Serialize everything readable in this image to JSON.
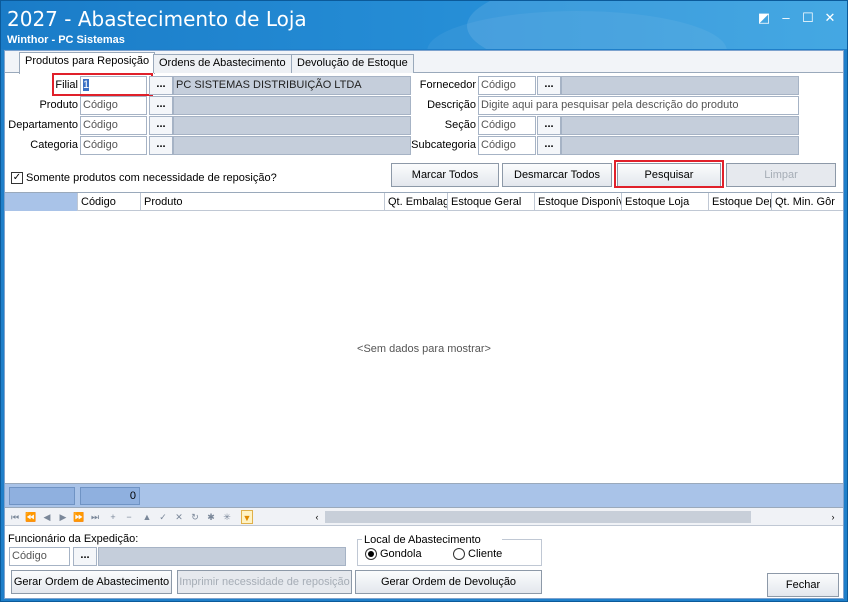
{
  "window": {
    "title": "2027 - Abastecimento de Loja",
    "subtitle": "Winthor - PC Sistemas",
    "buttons": [
      "restore-icon",
      "minimize-icon",
      "maximize-icon",
      "close-icon"
    ]
  },
  "tabs": [
    {
      "label": "Produtos para Reposição",
      "active": true
    },
    {
      "label": "Ordens de Abastecimento",
      "active": false
    },
    {
      "label": "Devolução de Estoque",
      "active": false
    }
  ],
  "filters": {
    "filial": {
      "label": "Filial",
      "value": "1",
      "description": "PC SISTEMAS DISTRIBUIÇÃO LTDA"
    },
    "produto": {
      "label": "Produto",
      "placeholder": "Código"
    },
    "departamento": {
      "label": "Departamento",
      "placeholder": "Código"
    },
    "categoria": {
      "label": "Categoria",
      "placeholder": "Código"
    },
    "fornecedor": {
      "label": "Fornecedor",
      "placeholder": "Código"
    },
    "descricao": {
      "label": "Descrição",
      "placeholder": "Digite aqui para pesquisar pela descrição do produto"
    },
    "secao": {
      "label": "Seção",
      "placeholder": "Código"
    },
    "subcategoria": {
      "label": "Subcategoria",
      "placeholder": "Código"
    },
    "dots": "...",
    "somente_reposicao": {
      "label": "Somente produtos com necessidade de reposição?",
      "checked": true
    }
  },
  "actions": {
    "marcar_todos": "Marcar Todos",
    "desmarcar_todos": "Desmarcar Todos",
    "pesquisar": "Pesquisar",
    "limpar": "Limpar"
  },
  "grid": {
    "columns": [
      "Código",
      "Produto",
      "Qt. Embalag",
      "Estoque Geral",
      "Estoque Disponív",
      "Estoque Loja",
      "Estoque Dep",
      "Qt. Min. Gôr"
    ],
    "empty_text": "<Sem dados para mostrar>",
    "footer_count": "0"
  },
  "bottom": {
    "funcionario_label": "Funcionário da Expedição:",
    "funcionario_placeholder": "Código",
    "local_label": "Local de Abastecimento",
    "radio_gondola": "Gondola",
    "radio_cliente": "Cliente",
    "selected": "Gondola",
    "btn_gerar_ordem": "Gerar Ordem de Abastecimento",
    "btn_imprimir": "Imprimir necessidade de reposição",
    "btn_gerar_devolucao": "Gerar Ordem de Devolução",
    "btn_fechar": "Fechar"
  }
}
